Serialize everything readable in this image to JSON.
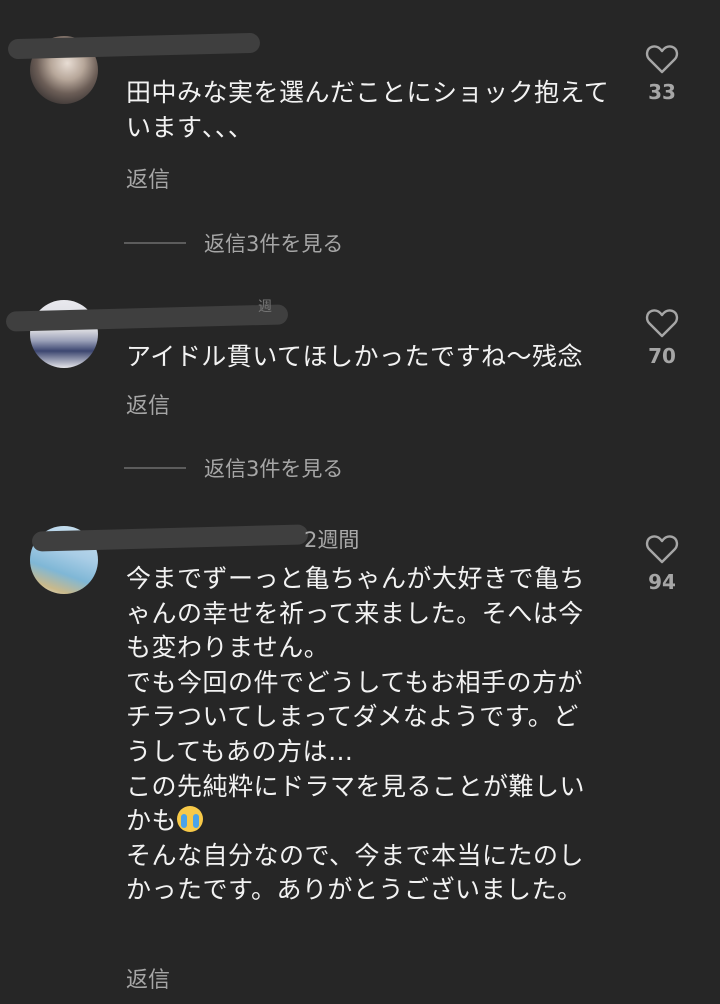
{
  "comments": [
    {
      "time": "",
      "text": "田中みな実を選んだことにショック抱えています､､､",
      "reply": "返信",
      "likes": "33",
      "view_replies": "返信3件を見る"
    },
    {
      "time": "週",
      "text": "アイドル貫いてほしかったですね〜残念",
      "reply": "返信",
      "likes": "70",
      "view_replies": "返信3件を見る"
    },
    {
      "time": "2週間",
      "text_lines": [
        "今までずーっと亀ちゃんが大好きで亀ち",
        "ゃんの幸せを祈って来ました。そへは今",
        "も変わりません。",
        "でも今回の件でどうしてもお相手の方が",
        "チラついてしまってダメなようです。ど",
        "うしてもあの方は…",
        "この先純粋にドラマを見ることが難しい",
        "かも",
        "そんな自分なので、今まで本当にたのし",
        "かったです。ありがとうございました。"
      ],
      "emoji": "loudly-crying-face",
      "reply": "返信",
      "likes": "94"
    }
  ],
  "colors": {
    "background": "#262626",
    "text": "#f2f2f2",
    "muted": "#a6a6a6"
  }
}
